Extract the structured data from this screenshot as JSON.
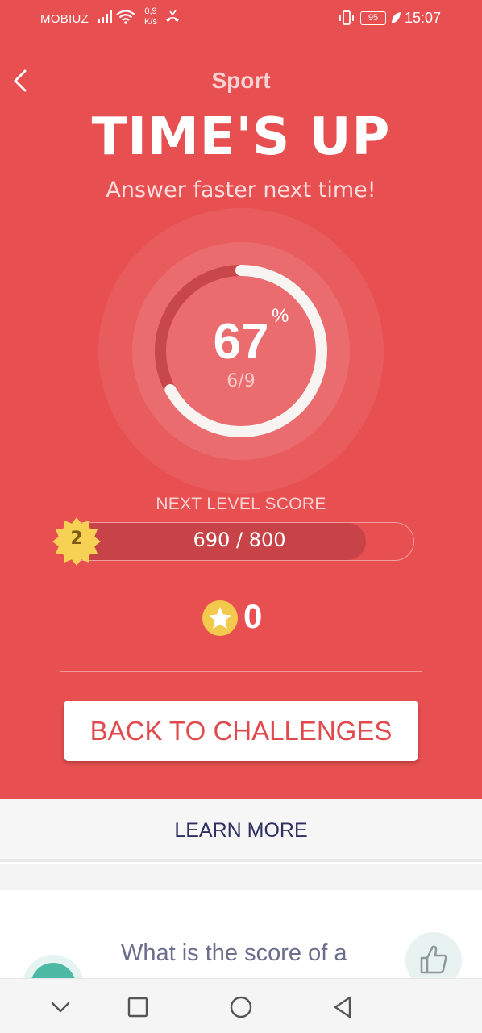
{
  "status_bar": {
    "carrier": "MOBIUZ",
    "speed_value": "0,9",
    "speed_unit": "K/s",
    "battery": "95",
    "time": "15:07"
  },
  "header": {
    "category": "Sport",
    "headline": "TIME'S UP",
    "subline": "Answer faster next time!"
  },
  "result": {
    "percent": "67",
    "percent_sign": "%",
    "fraction": "6/9",
    "progress_fraction": 0.67
  },
  "level": {
    "label": "NEXT LEVEL SCORE",
    "badge_number": "2",
    "score_text": "690 / 800",
    "score": 690,
    "target": 800
  },
  "coins": {
    "count": "0"
  },
  "actions": {
    "back_label": "BACK TO CHALLENGES",
    "learn_more_label": "LEARN MORE"
  },
  "card": {
    "question": "What is the score of a"
  },
  "colors": {
    "primary_red": "#e84f51",
    "dark_red": "#c84347",
    "badge_yellow": "#f7d154",
    "navy": "#2e3060",
    "teal": "#4cb9a5"
  },
  "icons": {
    "back": "chevron-left-icon",
    "coin": "star-coin-icon",
    "badge": "starburst-badge-icon",
    "like": "thumbs-up-icon",
    "nav": [
      "chevron-down-icon",
      "square-icon",
      "circle-icon",
      "triangle-back-icon"
    ]
  }
}
